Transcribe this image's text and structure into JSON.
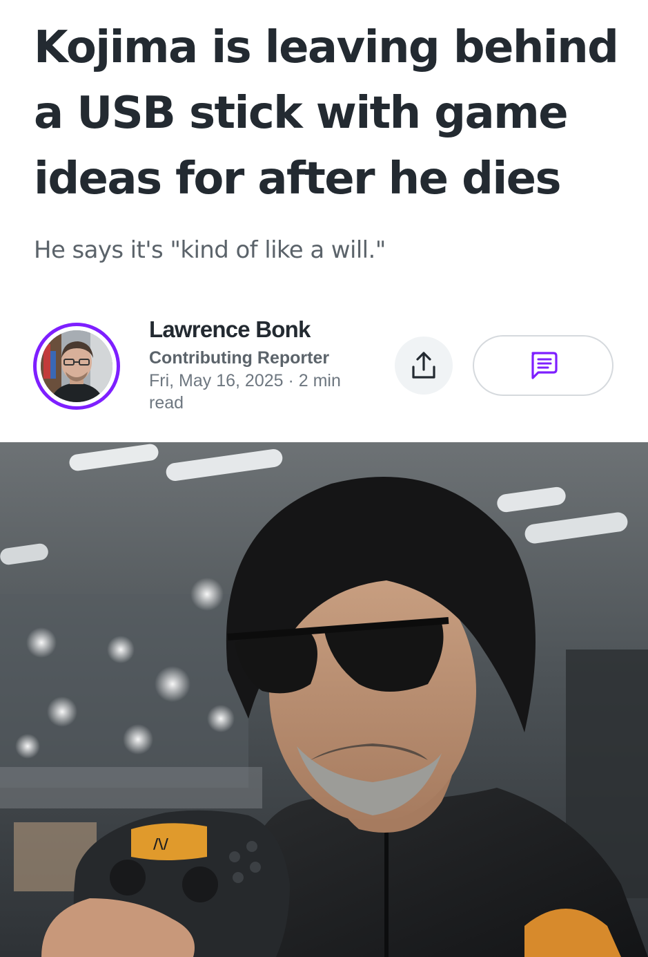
{
  "article": {
    "headline": "Kojima is leaving behind a USB stick with game ideas for after he dies",
    "subheadline": "He says it's \"kind of like a will.\""
  },
  "byline": {
    "author_name": "Lawrence Bonk",
    "author_role": "Contributing Reporter",
    "meta": "Fri, May 16, 2025 · 2 min read",
    "avatar_ring_color": "#7e1fff"
  },
  "actions": {
    "share_icon": "share-upload-icon",
    "comments_icon": "comment-bubble-icon",
    "accent_color": "#7e1fff"
  },
  "hero_image": {
    "controller_text": "/\\/"
  }
}
